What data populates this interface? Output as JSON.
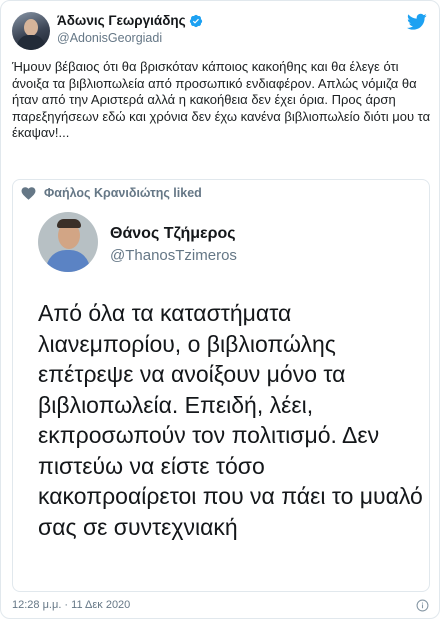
{
  "author": {
    "display_name": "Άδωνις Γεωργιάδης",
    "handle": "@AdonisGeorgiadi",
    "verified": true
  },
  "tweet": {
    "text": "Ήμουν βέβαιος ότι θα βρισκόταν κάποιος κακοήθης και θα έλεγε ότι άνοιξα τα βιβλιοπωλεία από προσωπικό ενδιαφέρον. Απλώς νόμιζα θα ήταν από την Αριστερά αλλά η κακοήθεια δεν έχει όρια. Προς άρση παρεξηγήσεων εδώ και χρόνια δεν έχω κανένα βιβλιοπωλείο διότι μου τα έκαψαν!..."
  },
  "quoted": {
    "liked_by": "Φαήλος Κρανιδιώτης liked",
    "display_name": "Θάνος Τζήμερος",
    "handle": "@ThanosTzimeros",
    "text": "Από όλα τα καταστήματα λιανεμπορίου, ο βιβλιοπώλης επέτρεψε να ανοίξουν μόνο τα βιβλιοπωλεία. Επειδή, λέει, εκπροσωπούν τον πολιτισμό. Δεν πιστεύω να είστε τόσο κακοπροαίρετοι που να πάει το μυαλό σας σε συντεχνιακή"
  },
  "footer": {
    "timestamp": "12:28 μ.μ. · 11 Δεκ 2020"
  },
  "icons": {
    "brand": "twitter-bird-icon",
    "verified": "verified-badge-icon",
    "liked": "heart-icon",
    "info": "info-icon"
  },
  "colors": {
    "brand_blue": "#1da1f2",
    "secondary_text": "#657786",
    "border": "#e1e8ed"
  }
}
